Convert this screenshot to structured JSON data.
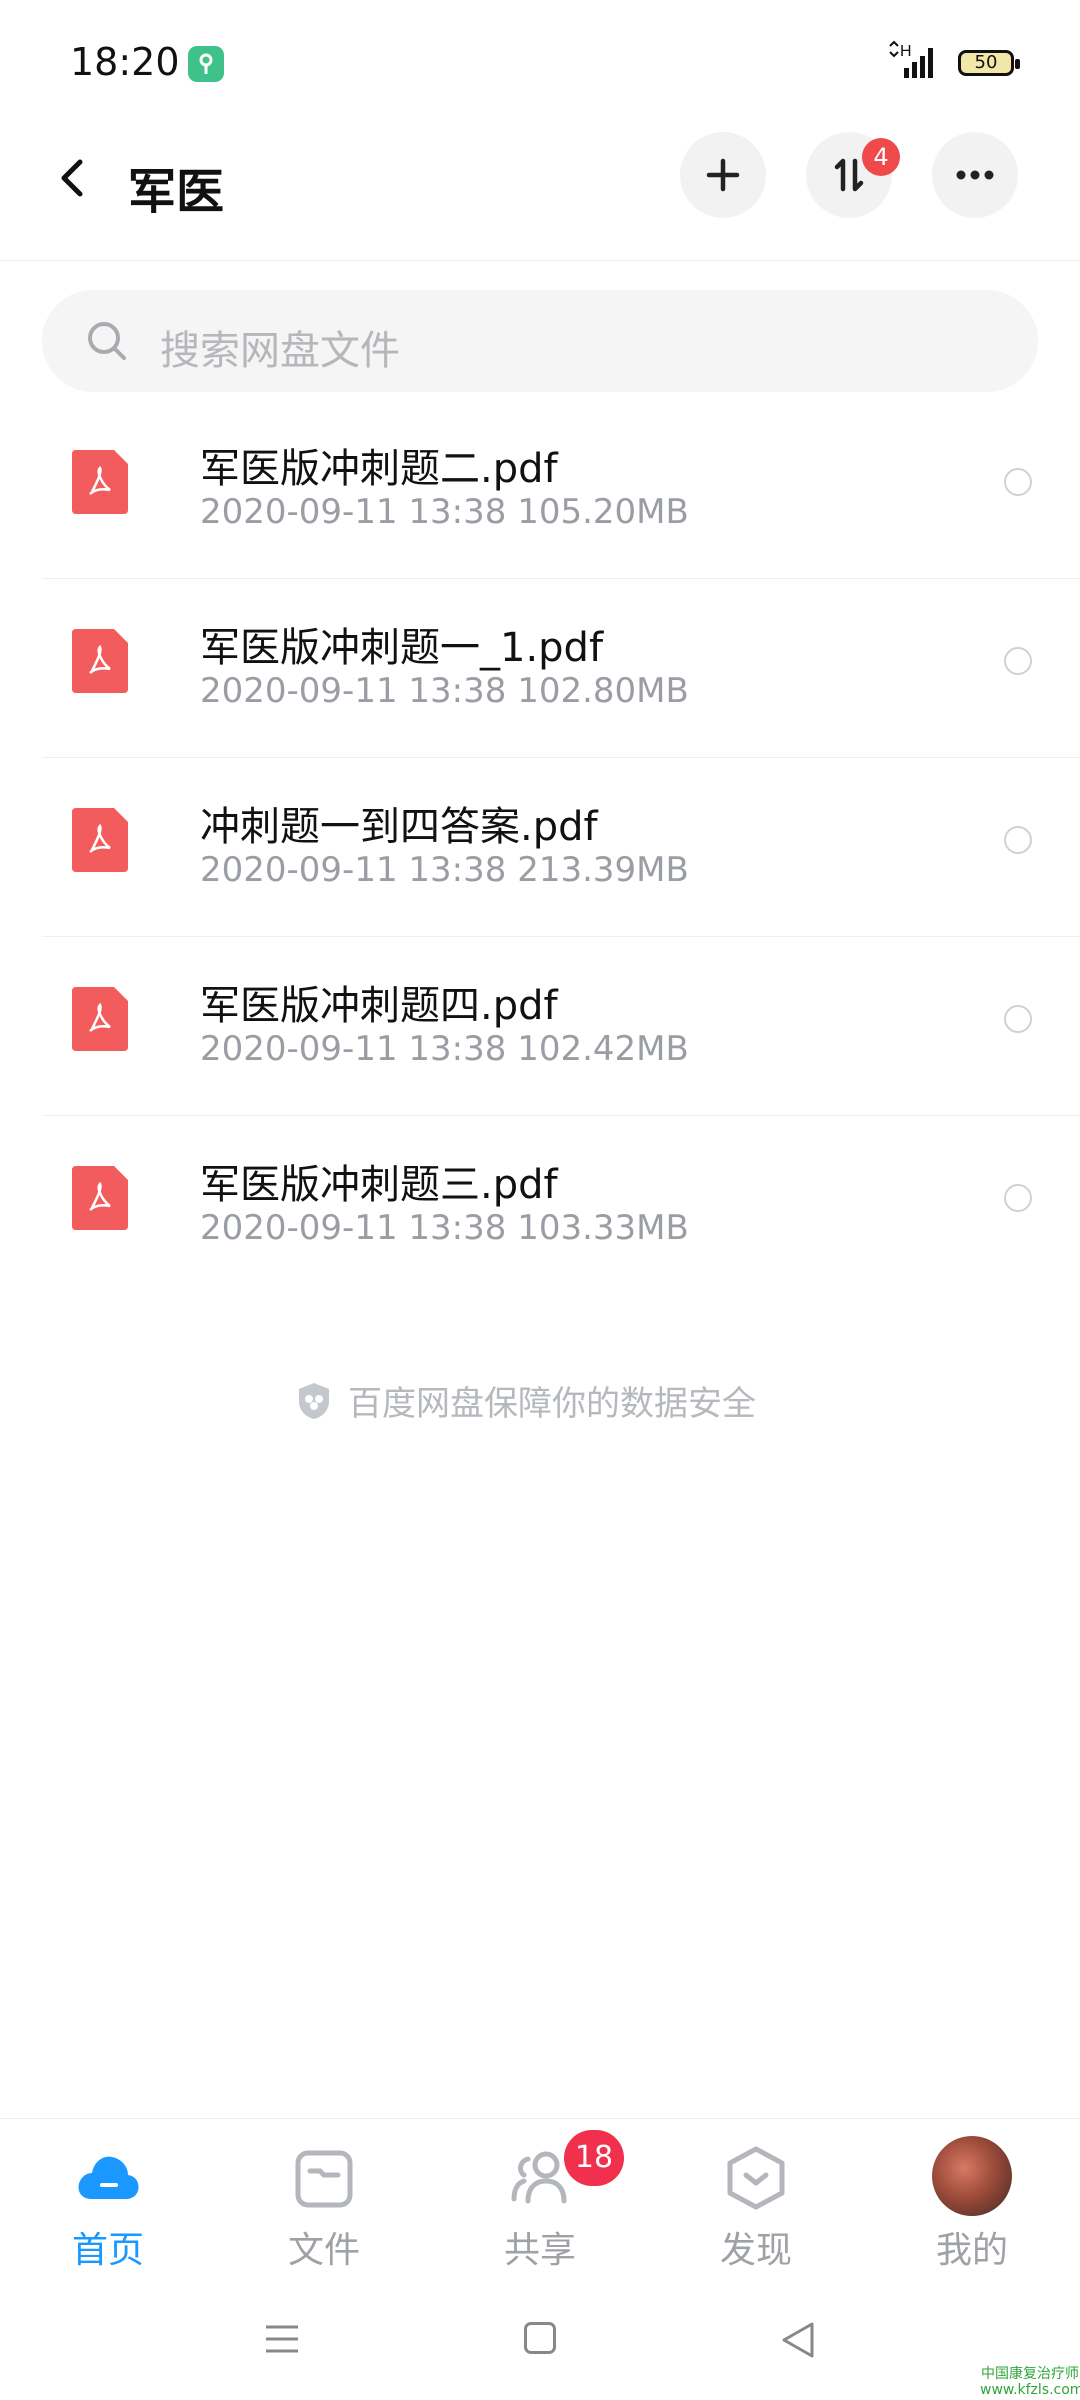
{
  "status_bar": {
    "time": "18:20",
    "network": "H",
    "battery": "50"
  },
  "header": {
    "back_label": "back",
    "title": "军医",
    "upload_badge": "4"
  },
  "search": {
    "placeholder": "搜索网盘文件"
  },
  "files": [
    {
      "name": "军医版冲刺题二.pdf",
      "date": "2020-09-11",
      "time": "13:38",
      "size": "105.20MB"
    },
    {
      "name": "军医版冲刺题一_1.pdf",
      "date": "2020-09-11",
      "time": "13:38",
      "size": "102.80MB"
    },
    {
      "name": "冲刺题一到四答案.pdf",
      "date": "2020-09-11",
      "time": "13:38",
      "size": "213.39MB"
    },
    {
      "name": "军医版冲刺题四.pdf",
      "date": "2020-09-11",
      "time": "13:38",
      "size": "102.42MB"
    },
    {
      "name": "军医版冲刺题三.pdf",
      "date": "2020-09-11",
      "time": "13:38",
      "size": "103.33MB"
    }
  ],
  "footer_note": "百度网盘保障你的数据安全",
  "bottom_nav": [
    {
      "label": "首页",
      "icon": "cloud-icon",
      "active": true
    },
    {
      "label": "文件",
      "icon": "folder-icon",
      "active": false
    },
    {
      "label": "共享",
      "icon": "people-icon",
      "active": false,
      "badge": "18"
    },
    {
      "label": "发现",
      "icon": "discover-icon",
      "active": false
    },
    {
      "label": "我的",
      "icon": "avatar",
      "active": false
    }
  ],
  "watermark": {
    "line1": "中国康复治疗师",
    "line2": "www.kfzls.com"
  },
  "colors": {
    "accent": "#1a98ff",
    "pdf": "#f25c5c",
    "badge": "#f0304c"
  }
}
